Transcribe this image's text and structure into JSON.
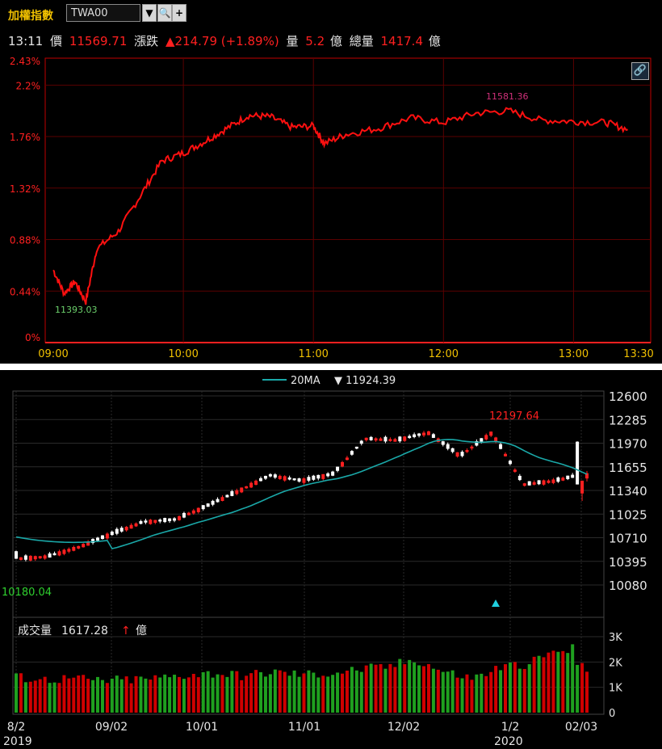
{
  "toolbar": {
    "title": "加權指數",
    "symbol": "TWA00",
    "dropdown_icon": "caret-down-icon",
    "search_icon": "search-icon",
    "add_icon": "plus-icon"
  },
  "quote": {
    "time": "13:11",
    "price_label": "價",
    "price": "11569.71",
    "change_label": "漲跌",
    "change": "▲214.79 (+1.89%)",
    "volume_label": "量",
    "volume": "5.2",
    "volume_unit": "億",
    "total_volume_label": "總量",
    "total_volume": "1417.4",
    "total_volume_unit": "億"
  },
  "intraday": {
    "y_ticks": [
      "2.43%",
      "2.2%",
      "1.76%",
      "1.32%",
      "0.88%",
      "0.44%",
      "0%"
    ],
    "x_ticks": [
      "09:00",
      "10:00",
      "11:00",
      "12:00",
      "13:00",
      "13:30"
    ],
    "high_label": "11581.36",
    "low_label": "11393.03",
    "link_icon": "link-icon"
  },
  "daily": {
    "ma_label": "20MA",
    "ma_value": "▼ 11924.39",
    "y_ticks": [
      "12600",
      "12285",
      "11970",
      "11655",
      "11340",
      "11025",
      "10710",
      "10395",
      "10080"
    ],
    "high_label": "12197.64",
    "low_label": "10180.04",
    "volume_title": "成交量",
    "volume_value": "1617.28",
    "volume_unit": "億",
    "volume_ticks": [
      "3K",
      "2K",
      "1K",
      "0"
    ],
    "x_ticks": [
      "8/2",
      "09/02",
      "10/01",
      "11/01",
      "12/02",
      "1/2",
      "02/03"
    ],
    "year_labels": [
      "2019",
      "2020"
    ]
  },
  "colors": {
    "up": "#ff2020",
    "down": "#ffffff",
    "ma": "#1aa8a8",
    "volume_up": "#d00000",
    "volume_down": "#1fa01f",
    "accent": "#f0c000"
  },
  "chart_data": [
    {
      "type": "line",
      "title": "",
      "xlabel": "",
      "ylabel": "",
      "ylim": [
        0,
        2.43
      ],
      "x": [
        "09:00",
        "09:05",
        "09:10",
        "09:15",
        "09:20",
        "09:30",
        "09:40",
        "09:50",
        "10:00",
        "10:10",
        "10:20",
        "10:30",
        "10:40",
        "10:50",
        "11:00",
        "11:05",
        "11:15",
        "11:30",
        "11:45",
        "12:00",
        "12:15",
        "12:30",
        "12:45",
        "13:00",
        "13:15",
        "13:25"
      ],
      "series": [
        {
          "values": [
            0.62,
            0.42,
            0.52,
            0.35,
            0.8,
            0.95,
            1.25,
            1.55,
            1.62,
            1.72,
            1.83,
            1.94,
            1.93,
            1.84,
            1.85,
            1.7,
            1.78,
            1.83,
            1.92,
            1.88,
            1.96,
            1.98,
            1.9,
            1.89,
            1.88,
            1.82
          ]
        }
      ],
      "annotations": [
        {
          "label": "11581.36"
        },
        {
          "label": "11393.03"
        }
      ]
    },
    {
      "type": "candlestick",
      "title": "",
      "ylim": [
        10080,
        12600
      ],
      "x": [
        "2019/08/02",
        "2019/09/02",
        "2019/10/01",
        "2019/11/01",
        "2019/12/02",
        "2020/01/02",
        "2020/02/03"
      ],
      "ohlc_sampled": [
        [
          10530,
          10600,
          10400,
          10430
        ],
        [
          10400,
          10480,
          10300,
          10460
        ],
        [
          10470,
          10620,
          10440,
          10590
        ],
        [
          10680,
          10790,
          10660,
          10760
        ],
        [
          10860,
          10950,
          10840,
          10920
        ],
        [
          10940,
          11000,
          10900,
          10950
        ],
        [
          11050,
          11160,
          11020,
          11130
        ],
        [
          11250,
          11360,
          11230,
          11330
        ],
        [
          11480,
          11560,
          11440,
          11540
        ],
        [
          11560,
          11590,
          11450,
          11470
        ],
        [
          11500,
          11580,
          11440,
          11560
        ],
        [
          11920,
          12060,
          11900,
          12030
        ],
        [
          12000,
          12110,
          11960,
          12010
        ],
        [
          12040,
          12197.64,
          11980,
          12110
        ],
        [
          11950,
          12020,
          11780,
          11800
        ],
        [
          12080,
          12140,
          12040,
          12110
        ],
        [
          11990,
          11995,
          11420,
          11420
        ],
        [
          11300,
          11470,
          11200,
          11470
        ],
        [
          11500,
          11600,
          11460,
          11570
        ]
      ],
      "ma20": {
        "name": "20MA",
        "last": 11924.39
      },
      "annotations": [
        {
          "label": "12197.64"
        },
        {
          "label": "10180.04"
        }
      ]
    },
    {
      "type": "bar",
      "title": "成交量",
      "unit": "億",
      "ylim": [
        0,
        3000
      ],
      "last": 1617.28,
      "values_sampled": [
        1400,
        1300,
        1350,
        1250,
        1300,
        1350,
        1500,
        1550,
        1450,
        1600,
        1500,
        1550,
        1700,
        1800,
        2100,
        1600,
        1350,
        1800,
        1950,
        2500,
        1617.28
      ]
    }
  ]
}
